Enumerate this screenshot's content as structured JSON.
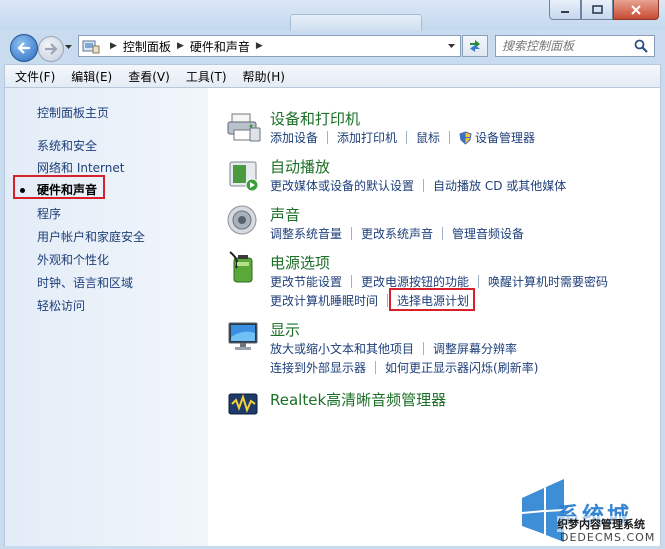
{
  "address_bar": {
    "crumbs": [
      "控制面板",
      "硬件和声音"
    ]
  },
  "search": {
    "placeholder": "搜索控制面板"
  },
  "menu": [
    "文件(F)",
    "编辑(E)",
    "查看(V)",
    "工具(T)",
    "帮助(H)"
  ],
  "sidebar": {
    "items": [
      "控制面板主页",
      "系统和安全",
      "网络和 Internet",
      "硬件和声音",
      "程序",
      "用户帐户和家庭安全",
      "外观和个性化",
      "时钟、语言和区域",
      "轻松访问"
    ],
    "active_index": 3
  },
  "categories": {
    "devices": {
      "title": "设备和打印机",
      "links": [
        "添加设备",
        "添加打印机",
        "鼠标",
        "设备管理器"
      ]
    },
    "autoplay": {
      "title": "自动播放",
      "links": [
        "更改媒体或设备的默认设置",
        "自动播放 CD 或其他媒体"
      ]
    },
    "sound": {
      "title": "声音",
      "links": [
        "调整系统音量",
        "更改系统声音",
        "管理音频设备"
      ]
    },
    "power": {
      "title": "电源选项",
      "links_row1": [
        "更改节能设置",
        "更改电源按钮的功能",
        "唤醒计算机时需要密码"
      ],
      "links_row2": [
        "更改计算机睡眠时间",
        "选择电源计划"
      ]
    },
    "display": {
      "title": "显示",
      "links_row1": [
        "放大或缩小文本和其他项目",
        "调整屏幕分辨率"
      ],
      "links_row2": [
        "连接到外部显示器",
        "如何更正显示器闪烁(刷新率)"
      ]
    },
    "realtek": {
      "title": "Realtek高清晰音频管理器"
    }
  },
  "watermark": {
    "line1": "系统城",
    "line2": "织梦内容管理系统",
    "line3": "DEDECMS.COM"
  },
  "colors": {
    "category_title": "#1b6f27",
    "link": "#1e3f7a",
    "highlight_box": "#d8202a"
  }
}
